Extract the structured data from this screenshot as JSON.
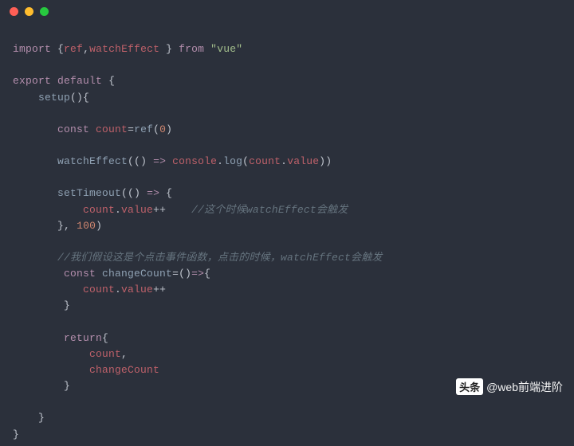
{
  "colors": {
    "close": "#ff5f56",
    "min": "#ffbd2e",
    "max": "#27c93f"
  },
  "code": {
    "l1": {
      "import": "import",
      "lb": "{",
      "ref": "ref",
      "c1": ",",
      "we": "watchEffect",
      "sp": " ",
      "rb": "}",
      "from": "from",
      "q1": "\"",
      "vue": "vue",
      "q2": "\""
    },
    "l3": {
      "export": "export",
      "default": "default",
      "lb": "{"
    },
    "l4": {
      "setup": "setup",
      "paren": "()",
      "lb": "{"
    },
    "l6": {
      "const": "const",
      "count": "count",
      "eq": "=",
      "ref": "ref",
      "lp": "(",
      "zero": "0",
      "rp": ")"
    },
    "l8": {
      "we": "watchEffect",
      "lp": "(",
      "lp2": "(",
      "rp2": ")",
      "arrow": " => ",
      "console": "console",
      "dot": ".",
      "log": "log",
      "lp3": "(",
      "count": "count",
      "dot2": ".",
      "value": "value",
      "rp3": ")",
      "rp": ")"
    },
    "l10": {
      "st": "setTimeout",
      "lp": "(",
      "lp2": "(",
      "rp2": ")",
      "arrow": " => ",
      "lb": "{"
    },
    "l11": {
      "count": "count",
      "dot": ".",
      "value": "value",
      "pp": "++",
      "cm": "//这个时候watchEffect会触发"
    },
    "l12": {
      "rb": "}",
      "c": ",",
      "num": "100",
      "rp": ")"
    },
    "l14": {
      "cm": "//我们假设这是个点击事件函数，点击的时候，watchEffect会触发"
    },
    "l15": {
      "const": "const",
      "cc": "changeCount",
      "eq": "=",
      "lp": "(",
      "rp": ")",
      "arrow": "=>",
      "lb": "{"
    },
    "l16": {
      "count": "count",
      "dot": ".",
      "value": "value",
      "pp": "++"
    },
    "l17": {
      "rb": "}"
    },
    "l19": {
      "return": "return",
      "lb": "{"
    },
    "l20": {
      "count": "count",
      "c": ","
    },
    "l21": {
      "cc": "changeCount"
    },
    "l22": {
      "rb": "}"
    },
    "l24": {
      "rb": "}"
    },
    "l25": {
      "rb": "}"
    }
  },
  "watermark": {
    "label": "头条",
    "handle": "@web前端进阶"
  }
}
